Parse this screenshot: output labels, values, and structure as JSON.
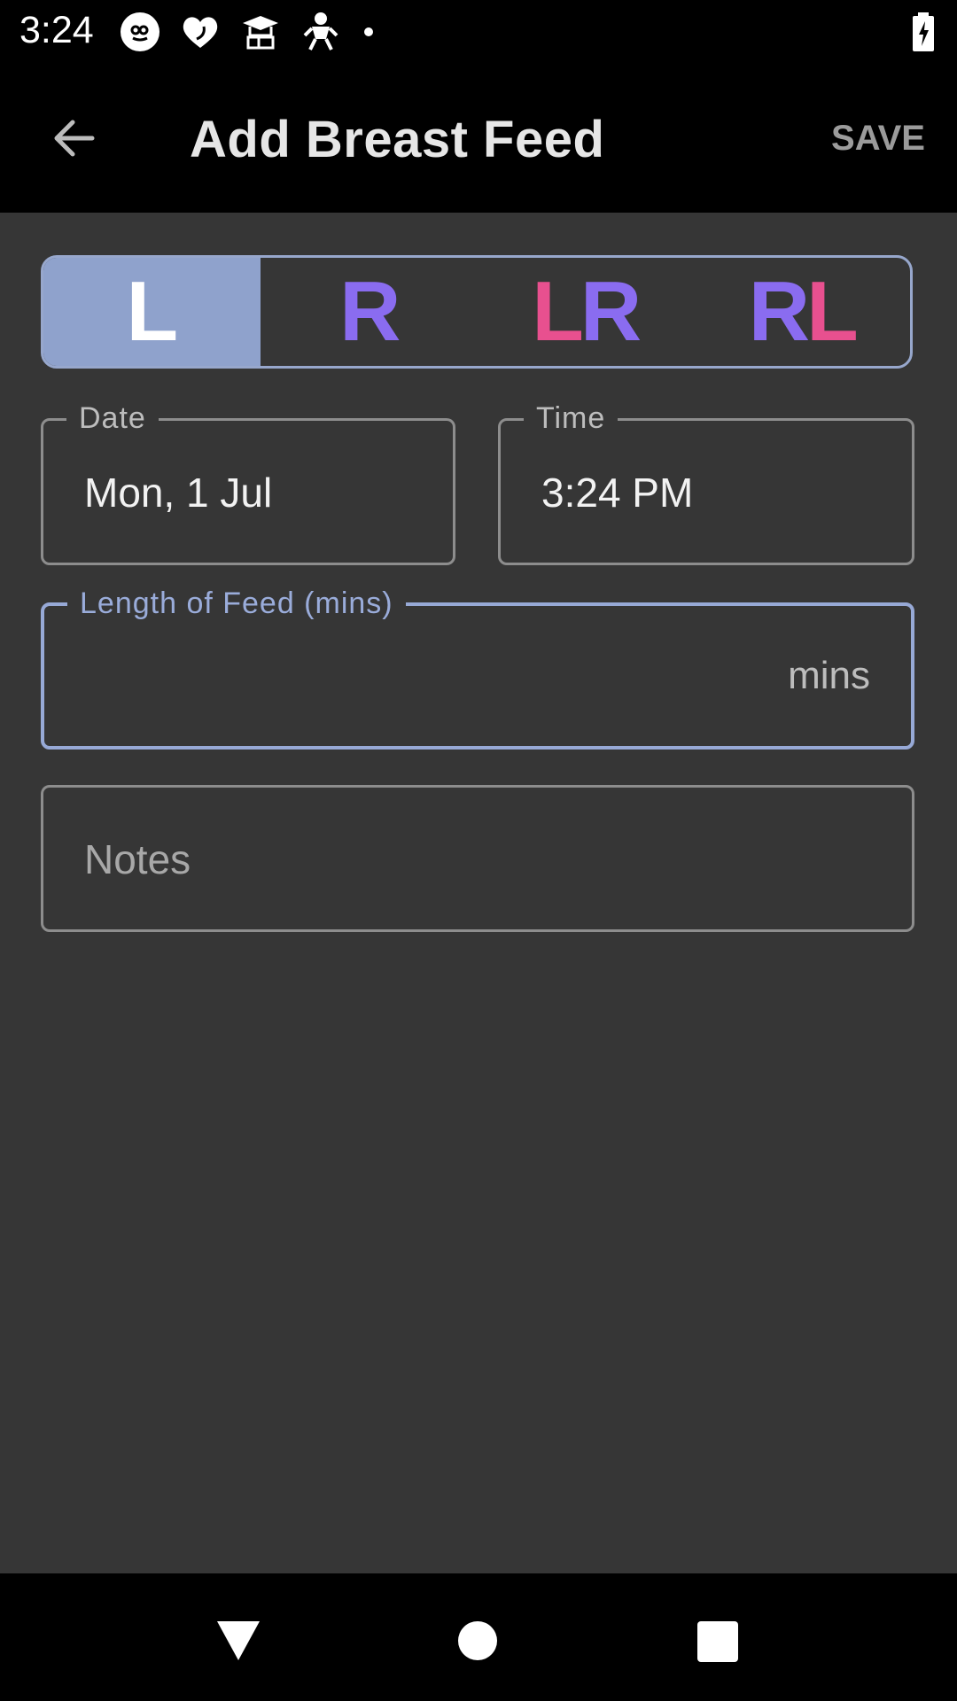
{
  "status": {
    "time": "3:24"
  },
  "appbar": {
    "title": "Add Breast Feed",
    "save_label": "SAVE"
  },
  "toggle": {
    "options": [
      {
        "label": "L",
        "selected": true
      },
      {
        "label": "R",
        "selected": false
      },
      {
        "label": "LR",
        "selected": false
      },
      {
        "label": "RL",
        "selected": false
      }
    ]
  },
  "date_field": {
    "label": "Date",
    "value": "Mon, 1 Jul"
  },
  "time_field": {
    "label": "Time",
    "value": "3:24 PM"
  },
  "length_field": {
    "label": "Length of Feed (mins)",
    "value": "",
    "suffix": "mins"
  },
  "notes_field": {
    "placeholder": "Notes"
  },
  "colors": {
    "accent": "#8fa2cc",
    "left": "#e8508f",
    "right": "#8a6cf0",
    "background": "#363636"
  }
}
